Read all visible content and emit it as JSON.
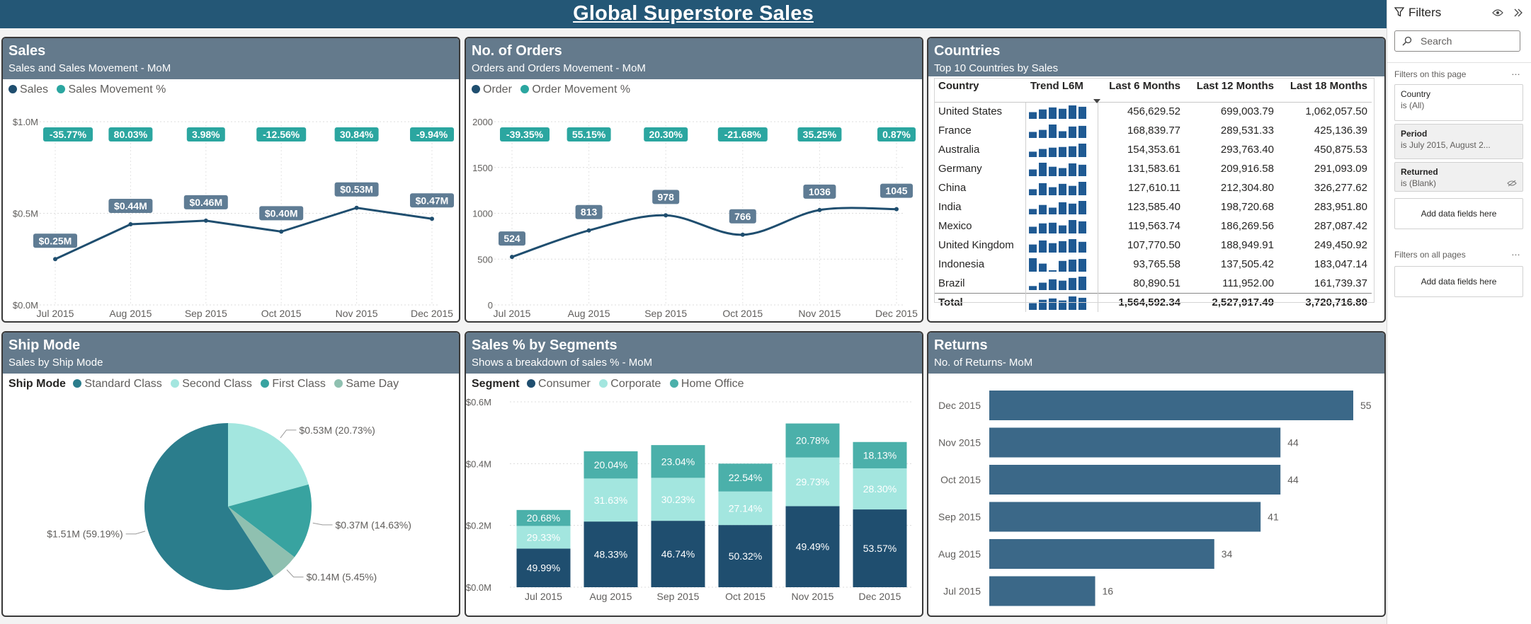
{
  "header": {
    "title": "Global Superstore Sales"
  },
  "sales": {
    "title": "Sales",
    "subtitle": "Sales and Sales Movement - MoM",
    "legend": [
      "Sales",
      "Sales Movement %"
    ],
    "colors": {
      "line": "#1f4e6f",
      "badge": "#2ba6a0"
    },
    "chart_data": {
      "type": "line",
      "x": [
        "Jul 2015",
        "Aug 2015",
        "Sep 2015",
        "Oct 2015",
        "Nov 2015",
        "Dec 2015"
      ],
      "series": [
        {
          "name": "Sales",
          "values": [
            0.25,
            0.44,
            0.46,
            0.4,
            0.53,
            0.47
          ]
        }
      ],
      "value_labels": [
        "$0.25M",
        "$0.44M",
        "$0.46M",
        "$0.40M",
        "$0.53M",
        "$0.47M"
      ],
      "movement_labels": [
        "-35.77%",
        "80.03%",
        "3.98%",
        "-12.56%",
        "30.84%",
        "-9.94%"
      ],
      "yticks": [
        "$0.0M",
        "$0.5M",
        "$1.0M"
      ],
      "ylim": [
        0,
        1.0
      ],
      "grid": true
    }
  },
  "orders": {
    "title": "No. of Orders",
    "subtitle": "Orders and Orders Movement - MoM",
    "legend": [
      "Order",
      "Order Movement %"
    ],
    "chart_data": {
      "type": "line",
      "x": [
        "Jul 2015",
        "Aug 2015",
        "Sep 2015",
        "Oct 2015",
        "Nov 2015",
        "Dec 2015"
      ],
      "series": [
        {
          "name": "Order",
          "values": [
            524,
            813,
            978,
            766,
            1036,
            1045
          ]
        }
      ],
      "value_labels": [
        "524",
        "813",
        "978",
        "766",
        "1036",
        "1045"
      ],
      "movement_labels": [
        "-39.35%",
        "55.15%",
        "20.30%",
        "-21.68%",
        "35.25%",
        "0.87%"
      ],
      "yticks": [
        "0",
        "500",
        "1000",
        "1500",
        "2000"
      ],
      "ylim": [
        0,
        2000
      ],
      "grid": true
    }
  },
  "countries": {
    "title": "Countries",
    "subtitle": "Top 10 Countries by Sales",
    "columns": [
      "Country",
      "Trend L6M",
      "Last 6 Months",
      "Last 12 Months",
      "Last 18 Months"
    ],
    "rows": [
      {
        "country": "United States",
        "l6": "456,629.52",
        "l12": "699,003.79",
        "l18": "1,062,057.50",
        "trend": [
          0.5,
          0.7,
          0.85,
          0.75,
          1.0,
          0.9
        ]
      },
      {
        "country": "France",
        "l6": "168,839.77",
        "l12": "289,531.33",
        "l18": "425,136.39",
        "trend": [
          0.45,
          0.6,
          1.0,
          0.5,
          0.85,
          0.9
        ]
      },
      {
        "country": "Australia",
        "l6": "154,353.61",
        "l12": "293,763.40",
        "l18": "450,875.53",
        "trend": [
          0.4,
          0.6,
          0.7,
          0.75,
          0.8,
          1.0
        ]
      },
      {
        "country": "Germany",
        "l6": "131,583.61",
        "l12": "209,916.58",
        "l18": "291,093.09",
        "trend": [
          0.5,
          1.0,
          0.7,
          0.6,
          0.95,
          0.85
        ]
      },
      {
        "country": "China",
        "l6": "127,610.11",
        "l12": "212,304.80",
        "l18": "326,277.62",
        "trend": [
          0.45,
          0.9,
          0.6,
          0.85,
          0.7,
          1.0
        ]
      },
      {
        "country": "India",
        "l6": "123,585.40",
        "l12": "198,720.68",
        "l18": "283,951.80",
        "trend": [
          0.4,
          0.7,
          0.5,
          0.9,
          0.8,
          1.0
        ]
      },
      {
        "country": "Mexico",
        "l6": "119,563.74",
        "l12": "186,269.56",
        "l18": "287,087.42",
        "trend": [
          0.5,
          0.75,
          0.8,
          0.6,
          1.0,
          0.9
        ]
      },
      {
        "country": "United Kingdom",
        "l6": "107,770.50",
        "l12": "188,949.91",
        "l18": "249,450.92",
        "trend": [
          0.6,
          0.9,
          0.7,
          0.85,
          1.0,
          0.8
        ]
      },
      {
        "country": "Indonesia",
        "l6": "93,765.58",
        "l12": "137,505.42",
        "l18": "183,047.14",
        "trend": [
          1.0,
          0.6,
          0.1,
          0.8,
          0.9,
          0.95
        ]
      },
      {
        "country": "Brazil",
        "l6": "80,890.51",
        "l12": "111,952.00",
        "l18": "161,739.37",
        "trend": [
          0.3,
          0.55,
          0.8,
          0.7,
          0.9,
          1.0
        ]
      }
    ],
    "total": {
      "label": "Total",
      "l6": "1,564,592.34",
      "l12": "2,527,917.49",
      "l18": "3,720,716.80",
      "trend": [
        0.5,
        0.75,
        0.85,
        0.7,
        1.0,
        0.9
      ]
    }
  },
  "shipmode": {
    "title": "Ship Mode",
    "subtitle": "Sales by Ship Mode",
    "legend_title": "Ship Mode",
    "chart_data": {
      "type": "pie",
      "slices": [
        {
          "name": "Standard Class",
          "value": 59.19,
          "label": "$1.51M (59.19%)",
          "color": "#2b7d8c"
        },
        {
          "name": "Second Class",
          "value": 20.73,
          "label": "$0.53M (20.73%)",
          "color": "#a3e6df"
        },
        {
          "name": "First Class",
          "value": 14.63,
          "label": "$0.37M (14.63%)",
          "color": "#38a3a0"
        },
        {
          "name": "Same Day",
          "value": 5.45,
          "label": "$0.14M (5.45%)",
          "color": "#8fc0b0"
        }
      ]
    }
  },
  "segments": {
    "title": "Sales % by Segments",
    "subtitle": "Shows a breakdown of sales % - MoM",
    "legend_title": "Segment",
    "chart_data": {
      "type": "bar",
      "categories": [
        "Jul 2015",
        "Aug 2015",
        "Sep 2015",
        "Oct 2015",
        "Nov 2015",
        "Dec 2015"
      ],
      "totals": [
        0.25,
        0.44,
        0.46,
        0.4,
        0.53,
        0.47
      ],
      "series": [
        {
          "name": "Consumer",
          "color": "#1f4e6f",
          "values": [
            49.99,
            48.33,
            46.74,
            50.32,
            49.49,
            53.57
          ]
        },
        {
          "name": "Corporate",
          "color": "#a3e6df",
          "values": [
            29.33,
            31.63,
            30.23,
            27.14,
            29.73,
            28.3
          ]
        },
        {
          "name": "Home Office",
          "color": "#4bb0aa",
          "values": [
            20.68,
            20.04,
            23.04,
            22.54,
            20.78,
            18.13
          ]
        }
      ],
      "yticks": [
        "$0.0M",
        "$0.2M",
        "$0.4M",
        "$0.6M"
      ],
      "ylim": [
        0,
        0.6
      ]
    }
  },
  "returns": {
    "title": "Returns",
    "subtitle": "No. of Returns- MoM",
    "chart_data": {
      "type": "bar",
      "orientation": "horizontal",
      "categories": [
        "Dec 2015",
        "Nov 2015",
        "Oct 2015",
        "Sep 2015",
        "Aug 2015",
        "Jul 2015"
      ],
      "values": [
        55,
        44,
        44,
        41,
        34,
        16
      ],
      "xlim": [
        0,
        55
      ],
      "color": "#3b6888"
    }
  },
  "filters": {
    "title": "Filters",
    "search_placeholder": "Search",
    "on_this_page": "Filters on this page",
    "on_all_pages": "Filters on all pages",
    "add_fields": "Add data fields here",
    "items": [
      {
        "name": "Country",
        "value": "is (All)"
      },
      {
        "name": "Period",
        "value": "is July 2015, August 2..."
      },
      {
        "name": "Returned",
        "value": "is (Blank)"
      }
    ]
  }
}
